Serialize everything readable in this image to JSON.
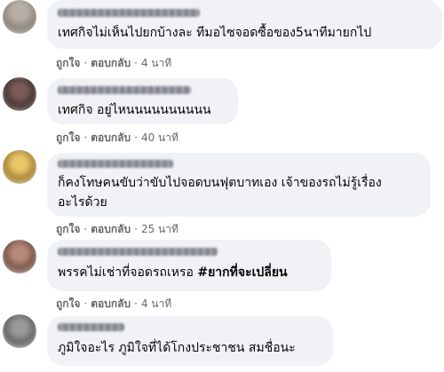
{
  "comments": [
    {
      "text": "เทศกิจไม่เห็นไปยกบ้างละ ทีมอไซจอดซื้อของ5นาทีมายกไป",
      "like": "ถูกใจ",
      "reply": "ตอบกลับ",
      "time": "4 นาที"
    },
    {
      "text": "เทศกิจ อยู่ไหนนนนนนนนนน",
      "like": "ถูกใจ",
      "reply": "ตอบกลับ",
      "time": "40 นาที"
    },
    {
      "text_line1": "ก็คงโทษคนขับว่าขับไปจอดบนฟุตบาทเอง เจ้าของรถไม่รู้เรื่อง",
      "text_line2": "อะไรด้วย",
      "like": "ถูกใจ",
      "reply": "ตอบกลับ",
      "time": "25 นาที"
    },
    {
      "text": "พรรคไม่เช่าที่จอดรถเหรอ",
      "hashtag": "#ยากที่จะเปลี่ยน",
      "like": "ถูกใจ",
      "reply": "ตอบกลับ",
      "time": "4 นาที"
    },
    {
      "text": "ภูมิใจอะไร ภูมิใจที่ได้โกงประชาชน สมชื่อนะ"
    }
  ],
  "colors": {
    "bubble": "#f0f2f5",
    "text": "#050505",
    "meta": "#65676b"
  }
}
